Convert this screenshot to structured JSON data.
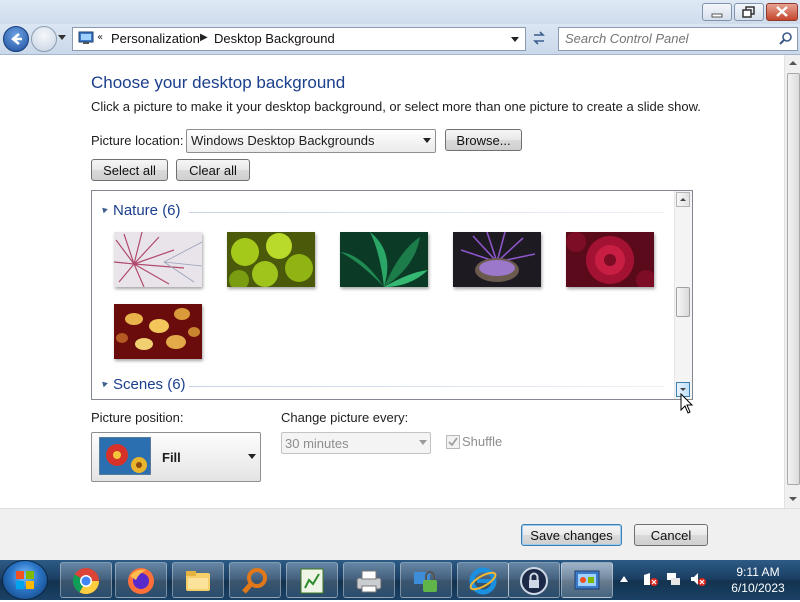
{
  "window": {
    "controls": [
      "minimize",
      "maximize",
      "close"
    ]
  },
  "address_bar": {
    "overflow": "«",
    "crumbs": [
      "Personalization",
      "Desktop Background"
    ],
    "search_placeholder": "Search Control Panel"
  },
  "main": {
    "title": "Choose your desktop background",
    "description": "Click a picture to make it your desktop background, or select more than one picture to create a slide show.",
    "picture_location_label": "Picture location:",
    "picture_location_value": "Windows Desktop Backgrounds",
    "browse_label": "Browse...",
    "select_all_label": "Select all",
    "clear_all_label": "Clear all",
    "groups": [
      {
        "label": "Nature (6)",
        "thumbnails": [
          "dandelion-white",
          "green-succulent",
          "green-leaves",
          "purple-thistle",
          "red-dahlia",
          "autumn-leaves"
        ]
      },
      {
        "label": "Scenes (6)",
        "thumbnails": []
      }
    ],
    "picture_position_label": "Picture position:",
    "picture_position_value": "Fill",
    "change_picture_label": "Change picture every:",
    "change_picture_value": "30 minutes",
    "shuffle_label": "Shuffle",
    "shuffle_checked": true
  },
  "footer": {
    "save_label": "Save changes",
    "cancel_label": "Cancel"
  },
  "taskbar": {
    "apps": [
      "chrome",
      "firefox",
      "file-explorer",
      "search-tool",
      "spreadsheet-app",
      "printer",
      "network-tool",
      "internet-explorer",
      "lock-app",
      "control-panel"
    ],
    "clock_time": "9:11 AM",
    "clock_date": "6/10/2023"
  },
  "colors": {
    "heading": "#1a3f8c",
    "taskbar": "#1a3e62"
  }
}
